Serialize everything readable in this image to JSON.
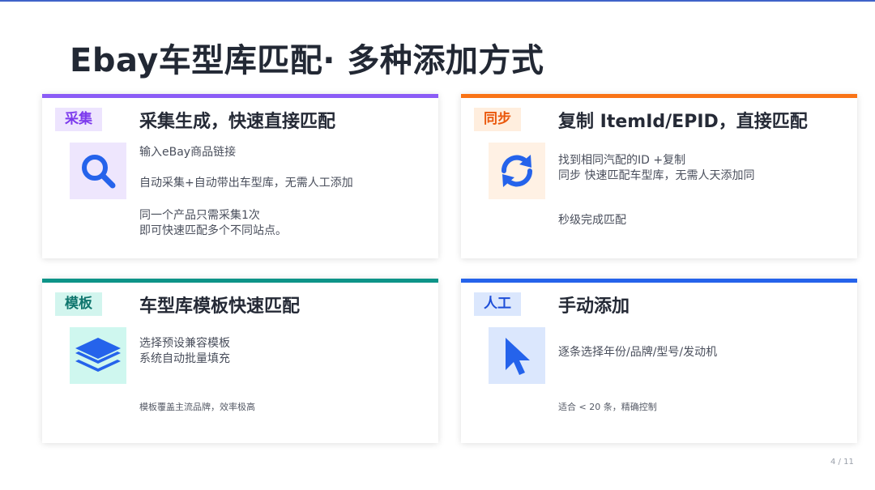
{
  "slide": {
    "title": "Ebay车型库匹配· 多种添加方式",
    "page_number": "4 / 11"
  },
  "cards": [
    {
      "tag": "采集",
      "title": "采集生成，快速直接匹配",
      "icon": "search-icon",
      "accent": "#8b5cf6",
      "lines": [
        "输入eBay商品链接",
        "自动采集+自动带出车型库，无需人工添加",
        "同一个产品只需采集1次",
        "即可快速匹配多个不同站点。"
      ]
    },
    {
      "tag": "同步",
      "title": "复制 ItemId/EPID，直接匹配",
      "icon": "sync-icon",
      "accent": "#f97316",
      "lines": [
        "找到相同汽配的ID  +复制",
        " 同步 快速匹配车型库，无需人天添加同",
        "秒级完成匹配"
      ]
    },
    {
      "tag": "模板",
      "title": "车型库模板快速匹配",
      "icon": "layers-icon",
      "accent": "#0d9488",
      "lines": [
        "选择预设兼容模板",
        "系统自动批量填充",
        "模板覆盖主流品牌，效率极高"
      ]
    },
    {
      "tag": "人工",
      "title": "手动添加",
      "icon": "cursor-icon",
      "accent": "#2563eb",
      "lines": [
        "逐条选择年份/品牌/型号/发动机",
        "适合 < 20 条，精确控制"
      ]
    }
  ]
}
